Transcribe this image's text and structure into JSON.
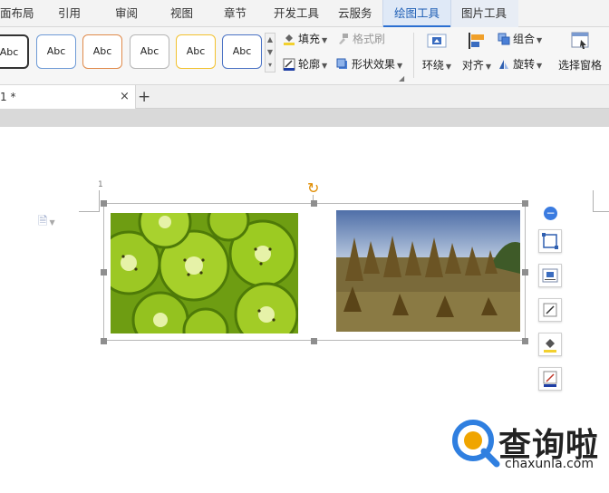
{
  "menu": {
    "tabs": [
      {
        "label": "面布局"
      },
      {
        "label": "引用"
      },
      {
        "label": "审阅"
      },
      {
        "label": "视图"
      },
      {
        "label": "章节"
      },
      {
        "label": "开发工具"
      },
      {
        "label": "云服务"
      },
      {
        "label": "绘图工具",
        "active": true
      },
      {
        "label": "图片工具"
      }
    ]
  },
  "ribbon": {
    "style_swatches": [
      {
        "label": "Abc",
        "border": "#333333"
      },
      {
        "label": "Abc",
        "border": "#6f9bd6"
      },
      {
        "label": "Abc",
        "border": "#e08a4a"
      },
      {
        "label": "Abc",
        "border": "#b5b5b5"
      },
      {
        "label": "Abc",
        "border": "#f2c12e"
      },
      {
        "label": "Abc",
        "border": "#4a72c4"
      }
    ],
    "fill": "填充",
    "format_painter": "格式刷",
    "outline": "轮廓",
    "shape_effects": "形状效果",
    "wrap": "环绕",
    "align": "对齐",
    "group": "组合",
    "rotate": "旋转",
    "selection_pane": "选择窗格"
  },
  "doc_tab": {
    "label": "1 *",
    "close": "×",
    "new": "+"
  },
  "page": {
    "page_number": "1"
  },
  "watermark": {
    "brand": "查询啦",
    "url": "chaxunla.com"
  },
  "colors": {
    "accent": "#2b6fd1",
    "handle": "#8e8e8e",
    "rotate_handle": "#e08c00",
    "watermark_blue": "#2f7fe0"
  },
  "icons": {
    "rotate_handle": "rotate-icon",
    "collapse": "minus-circle-icon",
    "tools": [
      "crop-icon",
      "wrap-text-icon",
      "edit-shape-icon",
      "fill-bucket-icon",
      "outline-pen-icon"
    ]
  }
}
